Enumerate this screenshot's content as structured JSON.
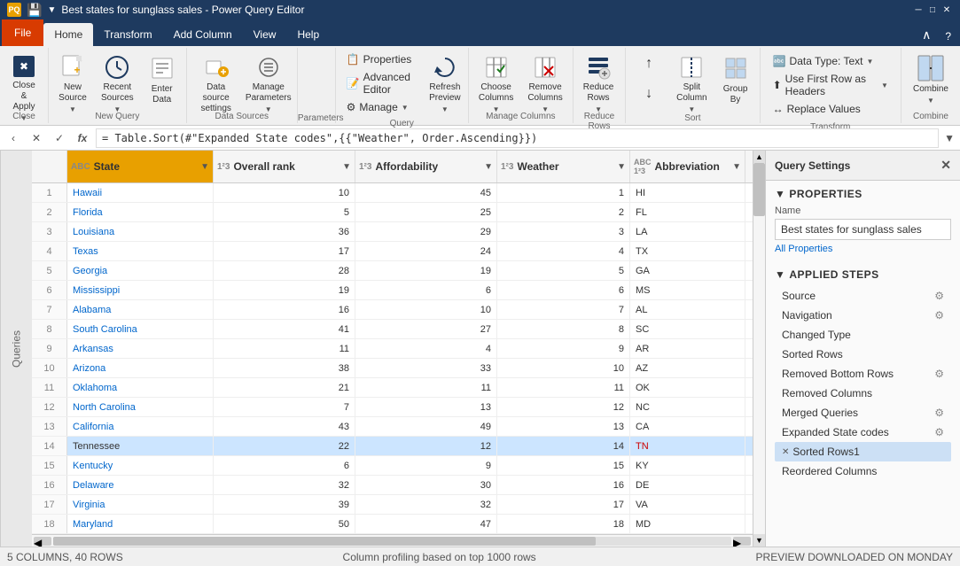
{
  "titlebar": {
    "title": "Best states for sunglass sales - Power Query Editor",
    "icon": "PQ"
  },
  "ribbon": {
    "tabs": [
      "File",
      "Home",
      "Transform",
      "Add Column",
      "View",
      "Help"
    ],
    "active_tab": "Home",
    "groups": {
      "close": {
        "label": "Close",
        "items": [
          {
            "label": "Close &\nApply",
            "icon": "✖",
            "dropdown": true
          }
        ]
      },
      "new_query": {
        "label": "New Query",
        "items": [
          {
            "label": "New\nSource",
            "icon": "📄",
            "dropdown": true
          },
          {
            "label": "Recent\nSources",
            "icon": "🕐",
            "dropdown": true
          },
          {
            "label": "Enter\nData",
            "icon": "📊"
          }
        ]
      },
      "data_sources": {
        "label": "Data Sources",
        "items": [
          {
            "label": "Data source\nsettings",
            "icon": "🔌"
          },
          {
            "label": "Manage\nParameters",
            "icon": "⚙",
            "dropdown": true
          }
        ]
      },
      "parameters": {
        "label": "Parameters",
        "items": []
      },
      "query": {
        "label": "Query",
        "items": [
          {
            "label": "Properties",
            "icon": "📋"
          },
          {
            "label": "Advanced Editor",
            "icon": "📝"
          },
          {
            "label": "Manage",
            "icon": "⚙",
            "dropdown": true
          },
          {
            "label": "Refresh\nPreview",
            "icon": "🔄",
            "dropdown": true
          }
        ]
      },
      "manage_columns": {
        "label": "Manage Columns",
        "items": [
          {
            "label": "Choose\nColumns",
            "icon": "⊞",
            "dropdown": true
          },
          {
            "label": "Remove\nColumns",
            "icon": "✂",
            "dropdown": true
          }
        ]
      },
      "reduce_rows": {
        "label": "Reduce Rows",
        "items": [
          {
            "label": "Reduce\nRows",
            "icon": "↕",
            "dropdown": true
          }
        ]
      },
      "sort": {
        "label": "Sort",
        "items": [
          {
            "label": "↑",
            "icon": "↑"
          },
          {
            "label": "↓",
            "icon": "↓"
          },
          {
            "label": "Split\nColumn",
            "icon": "⊟",
            "dropdown": true
          },
          {
            "label": "Group\nBy",
            "icon": "▦"
          }
        ]
      },
      "transform": {
        "label": "Transform",
        "items": [
          {
            "label": "Data Type: Text",
            "dropdown": true
          },
          {
            "label": "Use First Row as Headers",
            "dropdown": true
          },
          {
            "label": "Replace Values"
          }
        ]
      },
      "combine": {
        "label": "Combine",
        "items": [
          {
            "label": "Combine",
            "icon": "⊞"
          }
        ]
      }
    }
  },
  "formula_bar": {
    "cancel_label": "✕",
    "confirm_label": "✓",
    "fx_label": "fx",
    "formula": "= Table.Sort(#\"Expanded State codes\",{{\"Weather\", Order.Ascending}})"
  },
  "queries_panel": {
    "label": "Queries"
  },
  "grid": {
    "columns": [
      {
        "name": "State",
        "type": "ABC",
        "type_icon": "ABC",
        "filter": true
      },
      {
        "name": "Overall rank",
        "type": "1²3",
        "filter": true
      },
      {
        "name": "Affordability",
        "type": "1²3",
        "filter": true
      },
      {
        "name": "Weather",
        "type": "1²3",
        "filter": true
      },
      {
        "name": "Abbreviation",
        "type": "ABC 1²3",
        "filter": true
      }
    ],
    "rows": [
      {
        "num": 1,
        "state": "Hawaii",
        "overall": 10,
        "afford": 45,
        "weather": 1,
        "abbr": "HI"
      },
      {
        "num": 2,
        "state": "Florida",
        "overall": 5,
        "afford": 25,
        "weather": 2,
        "abbr": "FL"
      },
      {
        "num": 3,
        "state": "Louisiana",
        "overall": 36,
        "afford": 29,
        "weather": 3,
        "abbr": "LA"
      },
      {
        "num": 4,
        "state": "Texas",
        "overall": 17,
        "afford": 24,
        "weather": 4,
        "abbr": "TX"
      },
      {
        "num": 5,
        "state": "Georgia",
        "overall": 28,
        "afford": 19,
        "weather": 5,
        "abbr": "GA"
      },
      {
        "num": 6,
        "state": "Mississippi",
        "overall": 19,
        "afford": 6,
        "weather": 6,
        "abbr": "MS"
      },
      {
        "num": 7,
        "state": "Alabama",
        "overall": 16,
        "afford": 10,
        "weather": 7,
        "abbr": "AL"
      },
      {
        "num": 8,
        "state": "South Carolina",
        "overall": 41,
        "afford": 27,
        "weather": 8,
        "abbr": "SC"
      },
      {
        "num": 9,
        "state": "Arkansas",
        "overall": 11,
        "afford": 4,
        "weather": 9,
        "abbr": "AR"
      },
      {
        "num": 10,
        "state": "Arizona",
        "overall": 38,
        "afford": 33,
        "weather": 10,
        "abbr": "AZ"
      },
      {
        "num": 11,
        "state": "Oklahoma",
        "overall": 21,
        "afford": 11,
        "weather": 11,
        "abbr": "OK"
      },
      {
        "num": 12,
        "state": "North Carolina",
        "overall": 7,
        "afford": 13,
        "weather": 12,
        "abbr": "NC"
      },
      {
        "num": 13,
        "state": "California",
        "overall": 43,
        "afford": 49,
        "weather": 13,
        "abbr": "CA"
      },
      {
        "num": 14,
        "state": "Tennessee",
        "overall": 22,
        "afford": 12,
        "weather": 14,
        "abbr": "TN"
      },
      {
        "num": 15,
        "state": "Kentucky",
        "overall": 6,
        "afford": 9,
        "weather": 15,
        "abbr": "KY"
      },
      {
        "num": 16,
        "state": "Delaware",
        "overall": 32,
        "afford": 30,
        "weather": 16,
        "abbr": "DE"
      },
      {
        "num": 17,
        "state": "Virginia",
        "overall": 39,
        "afford": 32,
        "weather": 17,
        "abbr": "VA"
      },
      {
        "num": 18,
        "state": "Maryland",
        "overall": 50,
        "afford": 47,
        "weather": 18,
        "abbr": "MD"
      }
    ]
  },
  "query_settings": {
    "title": "Query Settings",
    "properties_label": "PROPERTIES",
    "name_label": "Name",
    "name_value": "Best states for sunglass sales",
    "all_properties_label": "All Properties",
    "applied_steps_label": "APPLIED STEPS",
    "steps": [
      {
        "name": "Source",
        "gear": true,
        "x": false
      },
      {
        "name": "Navigation",
        "gear": true,
        "x": false
      },
      {
        "name": "Changed Type",
        "gear": false,
        "x": false
      },
      {
        "name": "Sorted Rows",
        "gear": false,
        "x": false
      },
      {
        "name": "Removed Bottom Rows",
        "gear": true,
        "x": false
      },
      {
        "name": "Removed Columns",
        "gear": false,
        "x": false
      },
      {
        "name": "Merged Queries",
        "gear": true,
        "x": false
      },
      {
        "name": "Expanded State codes",
        "gear": true,
        "x": false
      },
      {
        "name": "Sorted Rows1",
        "gear": false,
        "x": true,
        "active": true
      },
      {
        "name": "Reordered Columns",
        "gear": false,
        "x": false
      }
    ]
  },
  "status_bar": {
    "left": "5 COLUMNS, 40 ROWS",
    "middle": "Column profiling based on top 1000 rows",
    "right": "PREVIEW DOWNLOADED ON MONDAY"
  }
}
